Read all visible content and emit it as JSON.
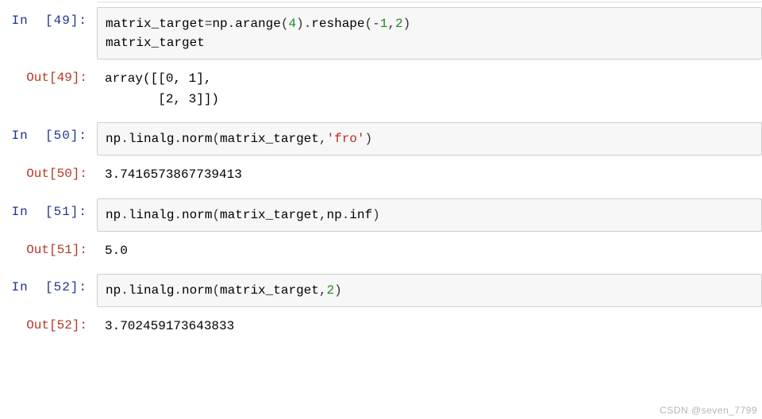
{
  "cells": [
    {
      "in_prompt": "In  [49]:",
      "out_prompt": "Out[49]:",
      "code_plain": "matrix_target=np.arange(4).reshape(-1,2)\nmatrix_target",
      "output": "array([[0, 1],\n       [2, 3]])"
    },
    {
      "in_prompt": "In  [50]:",
      "out_prompt": "Out[50]:",
      "code_plain": "np.linalg.norm(matrix_target,'fro')",
      "output": "3.7416573867739413"
    },
    {
      "in_prompt": "In  [51]:",
      "out_prompt": "Out[51]:",
      "code_plain": "np.linalg.norm(matrix_target,np.inf)",
      "output": "5.0"
    },
    {
      "in_prompt": "In  [52]:",
      "out_prompt": "Out[52]:",
      "code_plain": "np.linalg.norm(matrix_target,2)",
      "output": "3.702459173643833"
    }
  ],
  "watermark": "CSDN @seven_7799"
}
